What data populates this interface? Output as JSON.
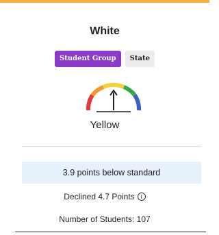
{
  "card": {
    "group_name": "White",
    "tabs": [
      {
        "label": "Student Group",
        "active": true
      },
      {
        "label": "State",
        "active": false
      }
    ],
    "gauge": {
      "icon": "performance-gauge",
      "colors": [
        "#e03a3a",
        "#f39a2e",
        "#f2d13a",
        "#3aa64a",
        "#3b5fc2"
      ],
      "status": "Yellow"
    },
    "distance_from_standard": "3.9 points below standard",
    "change": {
      "text": "Declined 4.7 Points",
      "icon": "info-icon"
    },
    "students": "Number of Students: 107"
  },
  "colors": {
    "accent_top": "#f2b33d",
    "active_tab": "#8a3cc9",
    "callout_bg": "#e6f1fb"
  }
}
